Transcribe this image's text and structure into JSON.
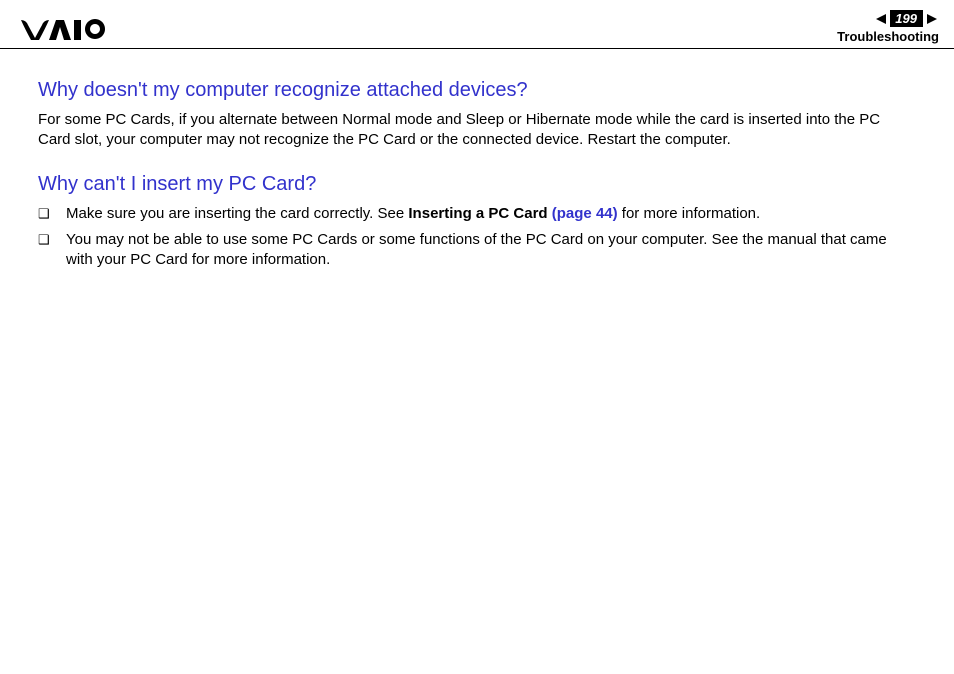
{
  "header": {
    "page_number": "199",
    "section": "Troubleshooting"
  },
  "content": {
    "h1": "Why doesn't my computer recognize attached devices?",
    "p1": "For some PC Cards, if you alternate between Normal mode and Sleep or Hibernate mode while the card is inserted into the PC Card slot, your computer may not recognize the PC Card or the connected device. Restart the computer.",
    "h2": "Why can't I insert my PC Card?",
    "b1_pre": "Make sure you are inserting the card correctly. See ",
    "b1_bold": "Inserting a PC Card ",
    "b1_link": "(page 44)",
    "b1_post": " for more information.",
    "b2": "You may not be able to use some PC Cards or some functions of the PC Card on your computer. See the manual that came with your PC Card for more information."
  }
}
